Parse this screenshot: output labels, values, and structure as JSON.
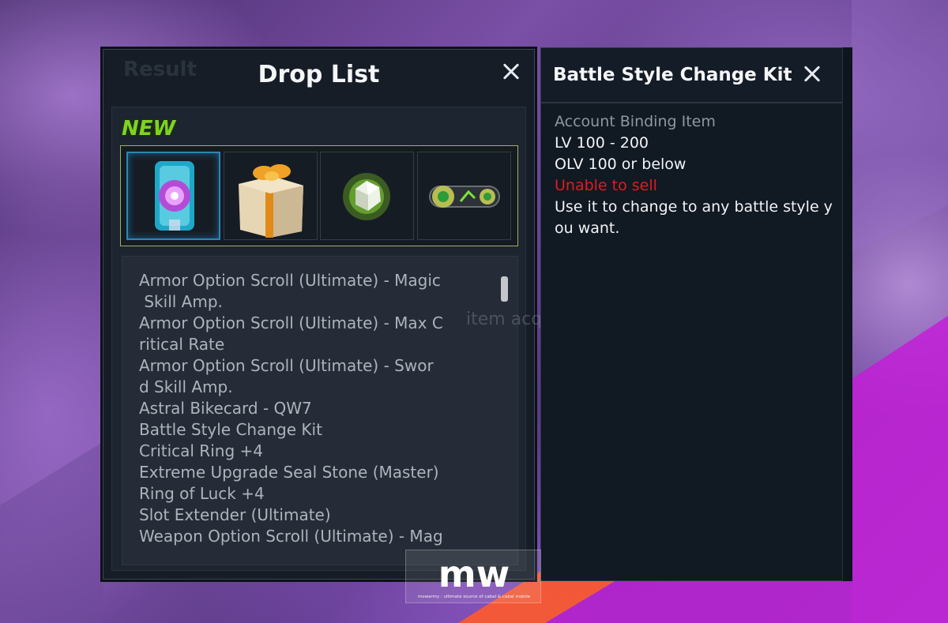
{
  "drop_list": {
    "ghost_title": "Result",
    "title": "Drop List",
    "new_label": "NEW",
    "ghost_message": "item acquired",
    "slots": [
      {
        "icon": "battle-style-kit-icon",
        "selected": true
      },
      {
        "icon": "gift-box-icon",
        "selected": false
      },
      {
        "icon": "green-gem-icon",
        "selected": false
      },
      {
        "icon": "bikecard-icon",
        "selected": false
      }
    ],
    "items": [
      "Armor Option Scroll (Ultimate) - Magic Skill Amp.",
      "Armor Option Scroll (Ultimate) - Max Critical Rate",
      "Armor Option Scroll (Ultimate) - Sword Skill Amp.",
      "Astral Bikecard - QW7",
      "Battle Style Change Kit",
      "Critical Ring +4",
      "Extreme Upgrade Seal Stone (Master)",
      "Ring of Luck +4",
      "Slot Extender (Ultimate)",
      "Weapon Option Scroll (Ultimate) - Mag"
    ],
    "items_lines": [
      "Armor Option Scroll (Ultimate) - Magic",
      " Skill Amp.",
      "Armor Option Scroll (Ultimate) - Max C",
      "ritical Rate",
      "Armor Option Scroll (Ultimate) - Swor",
      "d Skill Amp.",
      "Astral Bikecard - QW7",
      "Battle Style Change Kit",
      "Critical Ring +4",
      "Extreme Upgrade Seal Stone (Master)",
      "Ring of Luck +4",
      "Slot Extender (Ultimate)",
      "Weapon Option Scroll (Ultimate) - Mag"
    ]
  },
  "detail": {
    "title": "Battle Style Change Kit",
    "binding": "Account Binding Item",
    "level": "LV 100 - 200",
    "olv": "OLV 100 or below",
    "sell_status": "Unable to sell",
    "description_line1": "Use it to change to any battle style y",
    "description_line2": "ou want."
  },
  "watermark": {
    "logo_text": "mw",
    "tagline": "mowarmy : ultimate source of cabal & cabal mobile"
  },
  "colors": {
    "new_badge": "#7fd321",
    "warning": "#e01c1c",
    "panel_bg": "#161d27",
    "selected_border": "#2a86b8"
  }
}
